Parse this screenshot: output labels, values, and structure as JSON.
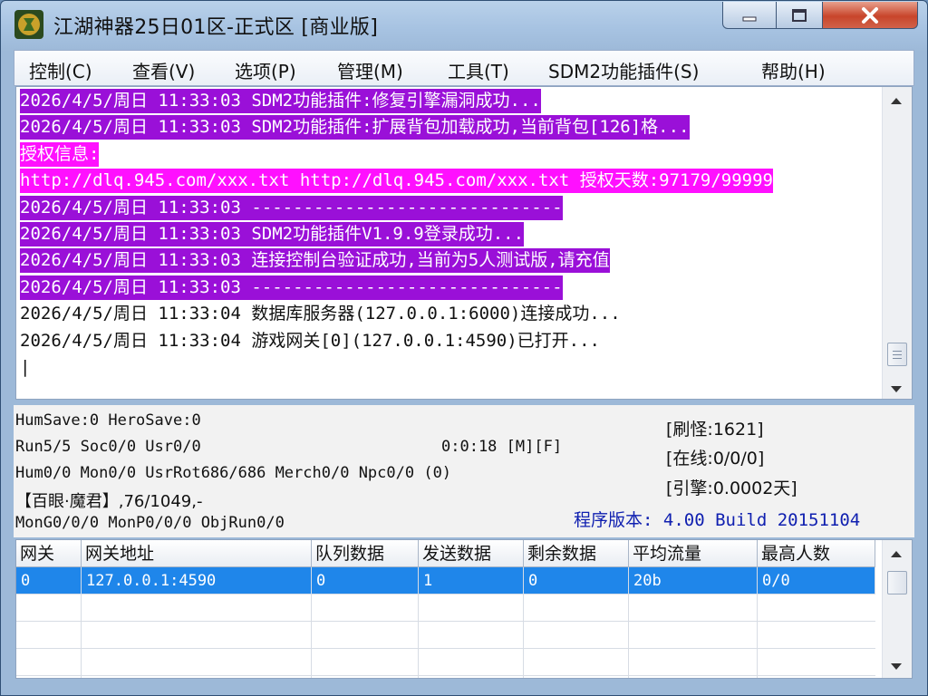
{
  "window": {
    "title": "江湖神器25日01区-正式区 [商业版]"
  },
  "menu": [
    "控制(C)",
    "查看(V)",
    "选项(P)",
    "管理(M)",
    "工具(T)",
    "SDM2功能插件(S)",
    "帮助(H)"
  ],
  "log": [
    {
      "text": "2026/4/5/周日 11:33:03 SDM2功能插件:修复引擎漏洞成功...",
      "style": "purple"
    },
    {
      "text": "2026/4/5/周日 11:33:03 SDM2功能插件:扩展背包加载成功,当前背包[126]格...",
      "style": "purple"
    },
    {
      "text": "授权信息:",
      "style": "magenta"
    },
    {
      "text": "http://dlq.945.com/xxx.txt http://dlq.945.com/xxx.txt 授权天数:97179/99999",
      "style": "magenta"
    },
    {
      "text": "2026/4/5/周日 11:33:03 ------------------------------",
      "style": "purple"
    },
    {
      "text": "2026/4/5/周日 11:33:03 SDM2功能插件V1.9.9登录成功...",
      "style": "purple"
    },
    {
      "text": "2026/4/5/周日 11:33:03 连接控制台验证成功,当前为5人测试版,请充值",
      "style": "purple"
    },
    {
      "text": "2026/4/5/周日 11:33:03 ------------------------------",
      "style": "purple"
    },
    {
      "text": "2026/4/5/周日 11:33:04 数据库服务器(127.0.0.1:6000)连接成功...",
      "style": "plain"
    },
    {
      "text": "2026/4/5/周日 11:33:04 游戏网关[0](127.0.0.1:4590)已打开...",
      "style": "plain"
    },
    {
      "text": "|",
      "style": "plain"
    }
  ],
  "status": {
    "line1": "HumSave:0 HeroSave:0",
    "line2": "Run5/5 Soc0/0 Usr0/0",
    "timer": "0:0:18 [M][F]",
    "line3": "Hum0/0 Mon0/0 UsrRot686/686 Merch0/0 Npc0/0 (0)",
    "line4": "【百眼·魔君】,76/1049,-",
    "line5": "MonG0/0/0 MonP0/0/0 ObjRun0/0",
    "refresh": "[刷怪:1621]",
    "online": "[在线:0/0/0]",
    "engine": "[引擎:0.0002天]",
    "version": "程序版本: 4.00 Build 20151104"
  },
  "gateway_table": {
    "headers": [
      "网关",
      "网关地址",
      "队列数据",
      "发送数据",
      "剩余数据",
      "平均流量",
      "最高人数"
    ],
    "rows": [
      [
        "0",
        "127.0.0.1:4590",
        "0",
        "1",
        "0",
        "20b",
        "0/0"
      ]
    ]
  },
  "colors": {
    "log_purple": "#9a10d8",
    "log_magenta": "#ff10ff",
    "selected_row": "#1f86ea",
    "version_text": "#1020b0"
  }
}
